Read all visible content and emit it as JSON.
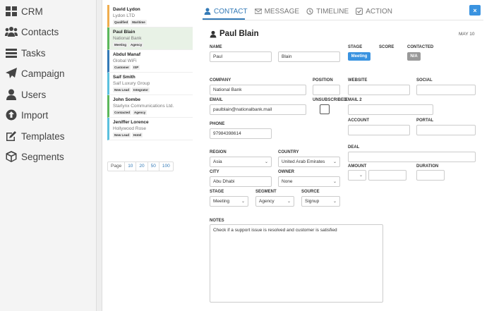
{
  "sidebar": {
    "items": [
      {
        "label": "CRM",
        "icon": "grid-icon"
      },
      {
        "label": "Contacts",
        "icon": "users-group-icon"
      },
      {
        "label": "Tasks",
        "icon": "list-icon"
      },
      {
        "label": "Campaign",
        "icon": "paper-plane-icon"
      },
      {
        "label": "Users",
        "icon": "user-icon"
      },
      {
        "label": "Import",
        "icon": "upload-circle-icon"
      },
      {
        "label": "Templates",
        "icon": "edit-icon"
      },
      {
        "label": "Segments",
        "icon": "cube-icon"
      }
    ]
  },
  "contacts": [
    {
      "name": "David Lydon",
      "company": "Lydon LTD",
      "tags": [
        "Qualified",
        "Maritime"
      ],
      "color": "#f0ad4e"
    },
    {
      "name": "Paul Blain",
      "company": "National Bank",
      "tags": [
        "Meeting",
        "Agency"
      ],
      "color": "#5cb85c"
    },
    {
      "name": "Abdul Manaf",
      "company": "Global WiFi",
      "tags": [
        "Customer",
        "ISP"
      ],
      "color": "#337ab7"
    },
    {
      "name": "Saif Smith",
      "company": "Saif Luxury Group",
      "tags": [
        "New Lead",
        "Integrator"
      ],
      "color": "#5bc0de"
    },
    {
      "name": "John Sombe",
      "company": "Starlynx Communications Ltd.",
      "tags": [
        "Contacted",
        "Agency"
      ],
      "color": "#5cb85c"
    },
    {
      "name": "Jeniffer Lorence",
      "company": "Hollywood Rose",
      "tags": [
        "New Lead",
        "Hotel"
      ],
      "color": "#5bc0de"
    }
  ],
  "pager": {
    "label": "Page",
    "sizes": [
      "10",
      "20",
      "50",
      "100"
    ]
  },
  "tabs": [
    {
      "label": "CONTACT",
      "icon": "user-icon"
    },
    {
      "label": "MESSAGE",
      "icon": "envelope-icon"
    },
    {
      "label": "TIMELINE",
      "icon": "clock-icon"
    },
    {
      "label": "ACTION",
      "icon": "check-square-icon"
    }
  ],
  "close_label": "×",
  "detail": {
    "title": "Paul Blain",
    "date": "MAY 10",
    "name_label": "NAME",
    "first_name": "Paul",
    "last_name": "Blain",
    "stage_label": "STAGE",
    "stage_value": "Meeting",
    "score_label": "SCORE",
    "contacted_label": "CONTACTED",
    "contacted_value": "N/A",
    "company_label": "COMPANY",
    "company": "National Bank",
    "position_label": "POSITION",
    "website_label": "WEBSITE",
    "social_label": "SOCIAL",
    "email_label": "EMAIL",
    "email": "paulblain@nationalbank.mail",
    "unsubscribed_label": "UNSUBSCRIBED",
    "email2_label": "EMAIL 2",
    "account_label": "ACCOUNT",
    "portal_label": "PORTAL",
    "phone_label": "PHONE",
    "phone": "97984398614",
    "deal_label": "DEAL",
    "region_label": "REGION",
    "region": "Asia",
    "country_label": "COUNTRY",
    "country": "United Arab Emirates",
    "amount_label": "AMOUNT",
    "duration_label": "DURATION",
    "city_label": "CITY",
    "city": "Abu Dhabi",
    "owner_label": "OWNER",
    "owner": "None",
    "stage2_label": "STAGE",
    "stage2": "Meeting",
    "segment_label": "SEGMENT",
    "segment": "Agency",
    "source_label": "SOURCE",
    "source": "Signup",
    "notes_label": "NOTES",
    "notes": "Check if a support issue is resolved and customer is satisfied"
  },
  "colors": {
    "accent": "#337ab7",
    "stage_badge": "#3a93e0",
    "contacted_badge": "#999999"
  }
}
